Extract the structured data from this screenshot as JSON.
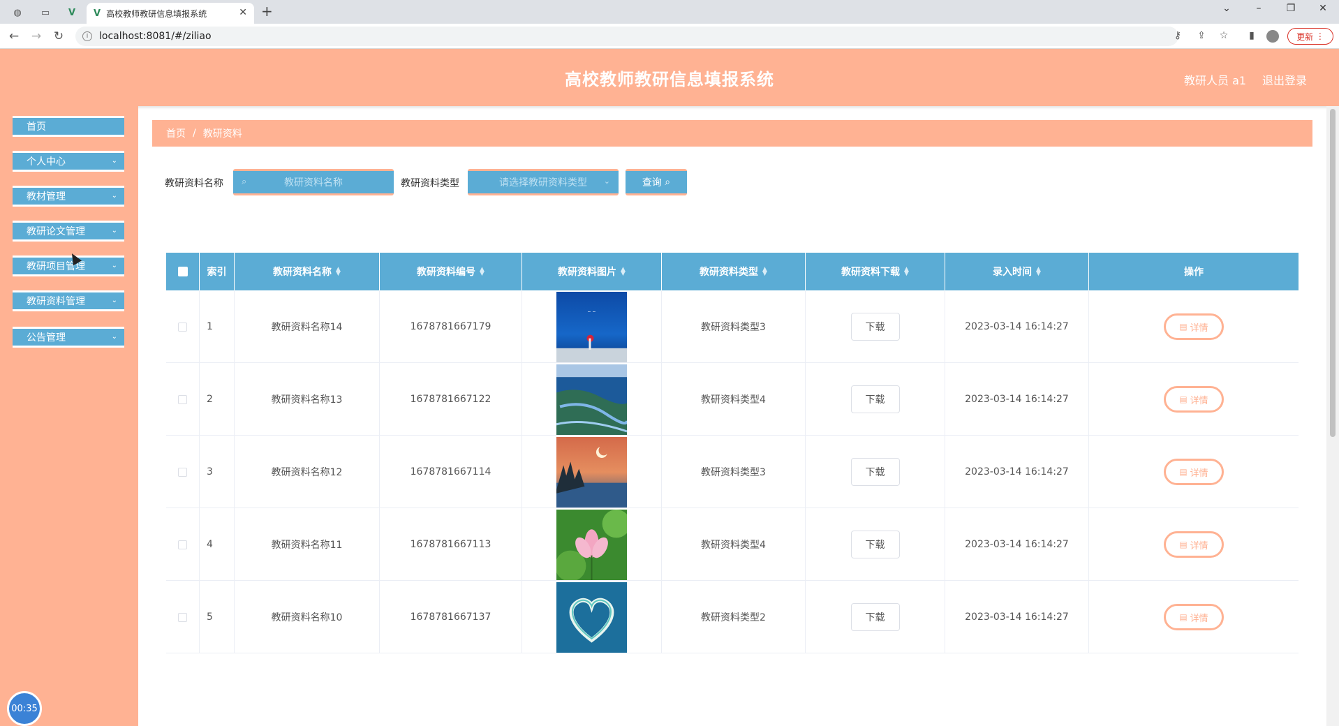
{
  "browser": {
    "tab_title": "高校教师教研信息填报系统",
    "url": "localhost:8081/#/ziliao",
    "update_label": "更新"
  },
  "header": {
    "title": "高校教师教研信息填报系统",
    "user": "教研人员 a1",
    "logout": "退出登录"
  },
  "sidebar": {
    "items": [
      {
        "label": "首页"
      },
      {
        "label": "个人中心"
      },
      {
        "label": "教材管理"
      },
      {
        "label": "教研论文管理"
      },
      {
        "label": "教研项目管理"
      },
      {
        "label": "教研资料管理"
      },
      {
        "label": "公告管理"
      }
    ],
    "timer": "00:35"
  },
  "breadcrumb": {
    "home": "首页",
    "sep": "/",
    "current": "教研资料"
  },
  "search": {
    "name_label": "教研资料名称",
    "name_placeholder": "教研资料名称",
    "type_label": "教研资料类型",
    "type_placeholder": "请选择教研资料类型",
    "query_label": "查询"
  },
  "table": {
    "headers": [
      "索引",
      "教研资料名称",
      "教研资料编号",
      "教研资料图片",
      "教研资料类型",
      "教研资料下载",
      "录入时间",
      "操作"
    ],
    "download_label": "下载",
    "detail_label": "详情",
    "rows": [
      {
        "index": "1",
        "name": "教研资料名称14",
        "code": "1678781667179",
        "type": "教研资料类型3",
        "time": "2023-03-14 16:14:27",
        "image": "ocean-person"
      },
      {
        "index": "2",
        "name": "教研资料名称13",
        "code": "1678781667122",
        "type": "教研资料类型4",
        "time": "2023-03-14 16:14:27",
        "image": "coastline"
      },
      {
        "index": "3",
        "name": "教研资料名称12",
        "code": "1678781667114",
        "type": "教研资料类型3",
        "time": "2023-03-14 16:14:27",
        "image": "sunset-lake"
      },
      {
        "index": "4",
        "name": "教研资料名称11",
        "code": "1678781667113",
        "type": "教研资料类型4",
        "time": "2023-03-14 16:14:27",
        "image": "lotus"
      },
      {
        "index": "5",
        "name": "教研资料名称10",
        "code": "1678781667137",
        "type": "教研资料类型2",
        "time": "2023-03-14 16:14:27",
        "image": "heart-island"
      }
    ]
  },
  "colors": {
    "header_bg": "#ffb293",
    "menu_bg": "#5bacd5",
    "accent": "#ffb293"
  }
}
